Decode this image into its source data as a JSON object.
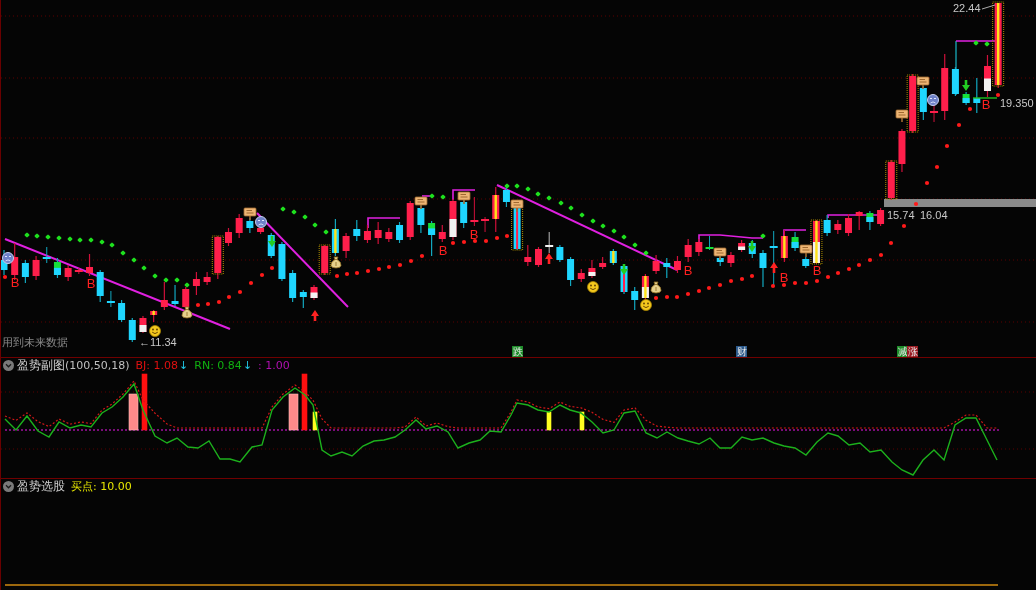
{
  "main_chart": {
    "price_labels": [
      "22.44",
      "19.350",
      "15.74",
      "16.04",
      "←11.34"
    ],
    "buy_marks": [
      "B",
      "B",
      "B",
      "B",
      "B",
      "B",
      "B",
      "B"
    ],
    "notice": "用到未来数据",
    "signal_tags": [
      {
        "text": "跌",
        "color": "#1e8c2a"
      },
      {
        "text": "财",
        "color": "#2c5a8c"
      },
      {
        "text": "减",
        "color": "#1e8c2a"
      },
      {
        "text": "涨",
        "color": "#9c1c24"
      }
    ]
  },
  "indicator_panel": {
    "title": "盈势副图",
    "params": "(100,50,18)",
    "readings": [
      {
        "label": "BJ: 1.08",
        "color": "#e01010",
        "arrow": "↓"
      },
      {
        "label": "RN: 0.84",
        "color": "#10b010",
        "arrow": "↓"
      },
      {
        "label": ": 1.00",
        "color": "#b010b0"
      }
    ]
  },
  "screener_panel": {
    "title": "盈势选股",
    "reading": "买点: 10.00"
  }
}
